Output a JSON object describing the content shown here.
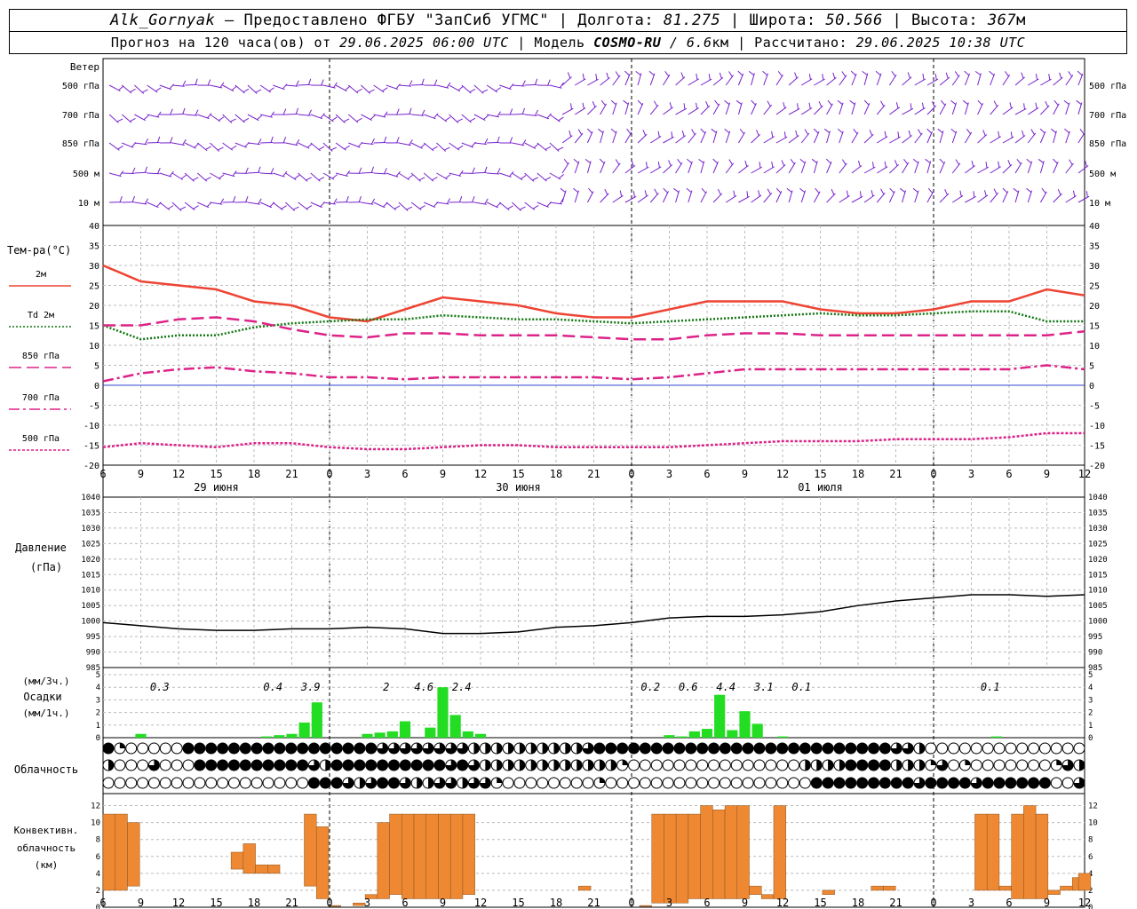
{
  "header": {
    "station": "Alk_Gornyak",
    "sep_dash": " – ",
    "provider": "Предоставлено ФГБУ \"ЗапСиб УГМС\"",
    "lon_label": " | Долгота: ",
    "lon_value": "81.275",
    "lat_label": " | Широта: ",
    "lat_value": "50.566",
    "alt_label": " | Высота: ",
    "alt_value": "367",
    "alt_unit": "м",
    "forecast_prefix": "Прогноз на 120 часа(ов) от ",
    "forecast_time": "29.06.2025 06:00 UTC",
    "model_label": "  | Модель ",
    "model_name": "COSMO-RU",
    "model_res": " / 6.6",
    "model_res_unit": "км",
    "calc_label": " | Рассчитано: ",
    "calc_time": "29.06.2025 10:38 UTC"
  },
  "colors": {
    "t2m": "#ee4433",
    "td2m": "#127712",
    "t850": "#dd2288",
    "t700": "#dd2288",
    "t500": "#dd2288",
    "pressure": "#000000",
    "precip": "#22dd22",
    "convective": "#ee8833",
    "wind": "#7722cc",
    "grid": "#bbbbbb"
  },
  "chart_data": [
    {
      "type": "wind-barbs",
      "panel_label": "Ветер",
      "levels": [
        "500 гПа",
        "700 гПа",
        "850 гПа",
        "500 м",
        "10  м"
      ]
    },
    {
      "type": "line",
      "panel_label": "Тем-ра(°C)",
      "ylim": [
        -20,
        40
      ],
      "yticks": [
        -20,
        -15,
        -10,
        -5,
        0,
        5,
        10,
        15,
        20,
        25,
        30,
        35,
        40
      ],
      "x_hours": [
        0,
        3,
        6,
        9,
        12,
        15,
        18,
        21,
        24,
        27,
        30,
        33,
        36,
        39,
        42,
        45,
        48,
        51,
        54,
        57,
        60,
        63,
        66,
        69,
        72,
        75,
        78
      ],
      "xticks": [
        "6",
        "9",
        "12",
        "15",
        "18",
        "21",
        "0",
        "3",
        "6",
        "9",
        "12",
        "15",
        "18",
        "21",
        "0",
        "3",
        "6",
        "9",
        "12",
        "15",
        "18",
        "21",
        "0",
        "3",
        "6",
        "9",
        "12"
      ],
      "day_labels": [
        "29 июня",
        "30 июня",
        "01 июля"
      ],
      "series": [
        {
          "name": "2м",
          "style": "solid",
          "values": [
            30,
            26,
            25,
            24,
            21,
            20,
            17,
            16,
            19,
            22,
            21,
            20,
            18,
            17,
            17,
            19,
            21,
            21,
            21,
            19,
            18,
            18,
            19,
            21,
            21,
            24,
            22.5
          ]
        },
        {
          "name": "Td  2м",
          "style": "dotted",
          "values": [
            15,
            11.5,
            12.5,
            12.5,
            14.5,
            15.5,
            16,
            16.5,
            16.5,
            17.5,
            17,
            16.5,
            16.5,
            16,
            15.5,
            16,
            16.5,
            17,
            17.5,
            18,
            17.5,
            17.5,
            18,
            18.5,
            18.5,
            16,
            16
          ]
        },
        {
          "name": "850 гПа",
          "style": "longdash",
          "values": [
            15,
            15,
            16.5,
            17,
            16,
            14,
            12.5,
            12,
            13,
            13,
            12.5,
            12.5,
            12.5,
            12,
            11.5,
            11.5,
            12.5,
            13,
            13,
            12.5,
            12.5,
            12.5,
            12.5,
            12.5,
            12.5,
            12.5,
            13.5
          ]
        },
        {
          "name": "700 гПа",
          "style": "dashdot",
          "values": [
            1,
            3,
            4,
            4.5,
            3.5,
            3,
            2,
            2,
            1.5,
            2,
            2,
            2,
            2,
            2,
            1.5,
            2,
            3,
            4,
            4,
            4,
            4,
            4,
            4,
            4,
            4,
            5,
            4
          ]
        },
        {
          "name": "500 гПа",
          "style": "dashed",
          "values": [
            -15.5,
            -14.5,
            -15,
            -15.5,
            -14.5,
            -14.5,
            -15.5,
            -16,
            -16,
            -15.5,
            -15,
            -15,
            -15.5,
            -15.5,
            -15.5,
            -15.5,
            -15,
            -14.5,
            -14,
            -14,
            -14,
            -13.5,
            -13.5,
            -13.5,
            -13,
            -12,
            -12
          ]
        }
      ]
    },
    {
      "type": "line",
      "panel_label": "Давление",
      "panel_unit": "(гПа)",
      "ylim": [
        985,
        1040
      ],
      "yticks": [
        985,
        990,
        995,
        1000,
        1005,
        1010,
        1015,
        1020,
        1025,
        1030,
        1035,
        1040
      ],
      "x_hours": [
        0,
        3,
        6,
        9,
        12,
        15,
        18,
        21,
        24,
        27,
        30,
        33,
        36,
        39,
        42,
        45,
        48,
        51,
        54,
        57,
        60,
        63,
        66,
        69,
        72,
        75,
        78
      ],
      "values": [
        999.5,
        998.5,
        997.5,
        997,
        997,
        997.5,
        997.5,
        998,
        997.5,
        996,
        996,
        996.5,
        998,
        998.5,
        999.5,
        1001,
        1001.5,
        1001.5,
        1002,
        1003,
        1005,
        1006.5,
        1007.5,
        1008.5,
        1008.5,
        1008,
        1008.5
      ]
    },
    {
      "type": "bar",
      "panel_label_top": "(мм/3ч.)",
      "panel_label": "Осадки",
      "panel_unit": "(мм/1ч.)",
      "ylim": [
        0,
        5
      ],
      "yticks": [
        0,
        1,
        2,
        3,
        4,
        5
      ],
      "hourly": [
        [
          3,
          0.3
        ],
        [
          13,
          0.1
        ],
        [
          14,
          0.2
        ],
        [
          15,
          0.3
        ],
        [
          16,
          1.2
        ],
        [
          17,
          2.8
        ],
        [
          21,
          0.3
        ],
        [
          22,
          0.4
        ],
        [
          23,
          0.5
        ],
        [
          24,
          1.3
        ],
        [
          26,
          0.8
        ],
        [
          27,
          4.0
        ],
        [
          28,
          1.8
        ],
        [
          29,
          0.5
        ],
        [
          30,
          0.3
        ],
        [
          45,
          0.2
        ],
        [
          46,
          0.1
        ],
        [
          47,
          0.5
        ],
        [
          48,
          0.7
        ],
        [
          49,
          3.4
        ],
        [
          50,
          0.6
        ],
        [
          51,
          2.1
        ],
        [
          52,
          1.1
        ],
        [
          54,
          0.1
        ],
        [
          71,
          0.1
        ]
      ],
      "totals_3h": [
        {
          "hour": 4.5,
          "label": "0.3"
        },
        {
          "hour": 13.5,
          "label": "0.4"
        },
        {
          "hour": 16.5,
          "label": "3.9"
        },
        {
          "hour": 22.5,
          "label": "2"
        },
        {
          "hour": 25.5,
          "label": "4.6"
        },
        {
          "hour": 28.5,
          "label": "2.4"
        },
        {
          "hour": 43.5,
          "label": "0.2"
        },
        {
          "hour": 46.5,
          "label": "0.6"
        },
        {
          "hour": 49.5,
          "label": "4.4"
        },
        {
          "hour": 52.5,
          "label": "3.1"
        },
        {
          "hour": 55.5,
          "label": "0.1"
        },
        {
          "hour": 70.5,
          "label": "0.1"
        }
      ]
    },
    {
      "type": "cloud-cover-symbols",
      "panel_label": "Облачность",
      "rows": [
        "41000004444444444444444433333333222222222234444444444444444444444444433200000000000000",
        "20003000444444444432444444444434322222222222210000000000000002222444422213010000000132",
        "00000000000000000044432344322332331000000001000000000000000000444444444344443444444003"
      ]
    },
    {
      "type": "bar",
      "panel_label": "Конвективн.",
      "panel_label2": "облачность",
      "panel_unit": "(км)",
      "ylim": [
        0,
        13
      ],
      "yticks": [
        0,
        2,
        4,
        6,
        8,
        10,
        12
      ],
      "bars": [
        [
          0.5,
          2,
          11
        ],
        [
          1.5,
          2,
          11
        ],
        [
          2.5,
          2.5,
          10
        ],
        [
          11,
          4.5,
          6.5
        ],
        [
          12,
          4,
          7.5
        ],
        [
          13,
          4,
          5
        ],
        [
          14,
          4,
          5
        ],
        [
          17,
          2.5,
          11
        ],
        [
          18,
          1,
          9.5
        ],
        [
          19,
          0.1,
          0.2
        ],
        [
          21,
          0.2,
          0.5
        ],
        [
          22,
          1,
          1.5
        ],
        [
          23,
          1,
          10
        ],
        [
          24,
          1.5,
          11
        ],
        [
          25,
          1,
          11
        ],
        [
          26,
          1,
          11
        ],
        [
          27,
          1,
          11
        ],
        [
          28,
          1,
          11
        ],
        [
          29,
          1,
          11
        ],
        [
          30,
          1.5,
          11
        ],
        [
          39.5,
          2,
          2.5
        ],
        [
          44.5,
          0.1,
          0.2
        ],
        [
          45.5,
          0.5,
          11
        ],
        [
          46.5,
          0.5,
          11
        ],
        [
          47.5,
          0.5,
          11
        ],
        [
          48.5,
          1,
          11
        ],
        [
          49.5,
          1,
          12
        ],
        [
          50.5,
          1,
          11.5
        ],
        [
          51.5,
          1,
          12
        ],
        [
          52.5,
          1,
          12
        ],
        [
          53.5,
          1.5,
          2.5
        ],
        [
          54.5,
          1,
          1.5
        ],
        [
          55.5,
          1,
          12
        ],
        [
          59.5,
          1.5,
          2
        ],
        [
          63.5,
          2,
          2.5
        ],
        [
          64.5,
          2,
          2.5
        ],
        [
          72,
          2,
          11
        ],
        [
          73,
          2,
          11
        ],
        [
          74,
          2,
          2.5
        ],
        [
          75,
          1,
          11
        ],
        [
          76,
          1,
          12
        ],
        [
          77,
          1,
          11
        ],
        [
          78,
          1.5,
          2
        ],
        [
          79,
          2,
          2.5
        ],
        [
          80,
          2,
          3.5
        ],
        [
          80.5,
          2,
          4
        ]
      ]
    }
  ]
}
